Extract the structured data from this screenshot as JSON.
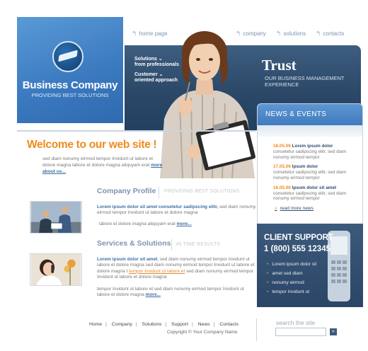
{
  "logo": {
    "title": "Business Company",
    "subtitle": "PROVIDING BEST SOLUTIONS"
  },
  "nav": [
    {
      "label": "home page"
    },
    {
      "label": "company"
    },
    {
      "label": "solutions"
    },
    {
      "label": "contacts"
    }
  ],
  "header": {
    "item1": {
      "line1": "Solutions",
      "line2": "from professionals"
    },
    "item2": {
      "line1": "Customer",
      "line2": "oriented approach"
    },
    "trust_title": "Trust",
    "trust_sub": "OUR BUSINESS MANAGEMENT EXPERIENCE"
  },
  "welcome": {
    "title": "Welcome to our web site !",
    "text": "sed diam nonumy eirmod tempor Invidunt ut labore et dolore magna  labore et dolore magna aliquyam erat",
    "more": "more about us..."
  },
  "company_profile": {
    "title": "Company Profile",
    "subtitle": "PROVIDING BEST SOLUTIONS",
    "lead": "Lorem ipsum dolor sit amet consetetur sadipscing elitr,",
    "text": " sed diam nonumy eirmod tempor Invidunt ut labore et dolore magna",
    "text2": "labore et dolore magna aliquyam erat",
    "more": "more..."
  },
  "services": {
    "title": "Services & Solutions",
    "subtitle": "IN TIME RESULTS",
    "lead": "Lorem ipsum dolor sit amet",
    "text_a": ", sed diam nonumy eirmod tempor Invidunt ut labore et dolore magna sed diam nonumy eirmod tempor Invidunt ut labore et dolore magna t ",
    "highlight": "tempor Invidunt ut labore et",
    "text_b": " sed diam nonumy eirmod tempor Invidunt ut labore et dolore magna",
    "text2": "tempor Invidunt ut labore et  sed diam nonumy eirmod tempor Invidunt ut labore et dolore magna",
    "more": "more..."
  },
  "news": {
    "title": "NEWS & EVENTS",
    "items": [
      {
        "date": "18.05.06",
        "title": "Lorem ipsum dolor",
        "text": "consetetur sadipscing elitr, sed diam nonumy eirmod tempor"
      },
      {
        "date": "17.05.06",
        "title": "Ipsum dolor",
        "text": "consetetur sadipscing elitr, sed diam nonumy eirmod tempor"
      },
      {
        "date": "16.05.06",
        "title": "Ipsum dolor sit amet",
        "text": "consetetur sadipscing elitr, sed diam nonumy eirmod tempor"
      }
    ],
    "read_more": "read more news"
  },
  "support": {
    "title": "CLIENT SUPPORT",
    "phone": "1 (800) 555 12345",
    "items": [
      "Lorem ipsum dolor sit",
      "amet  sed diam",
      "nonumy eirmod",
      "tempor Invidunt ut"
    ]
  },
  "footer": {
    "links": [
      "Home",
      "Company",
      "Solutions",
      "Support",
      "News",
      "Contacts"
    ],
    "copyright": "Copyright © Your Company Name"
  },
  "search": {
    "label": "search the site",
    "button": "»"
  },
  "colors": {
    "accent_orange": "#f08a1c",
    "navy": "#2b4868",
    "blue": "#3f7bbf"
  }
}
